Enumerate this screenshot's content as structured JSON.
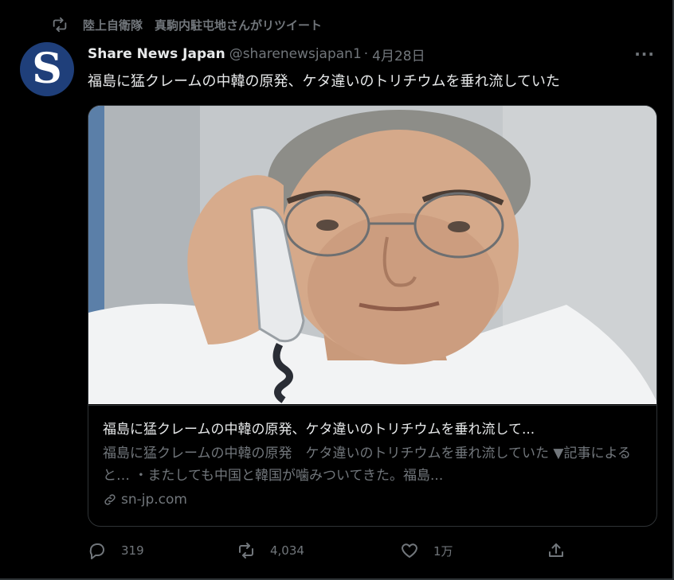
{
  "retweet": {
    "text": "陸上自衛隊　真駒内駐屯地さんがリツイート",
    "icon": "retweet-icon"
  },
  "tweet": {
    "avatar_letter": "S",
    "display_name": "Share News Japan",
    "handle": "@sharenewsjapan1",
    "separator": "·",
    "date": "4月28日",
    "more": "···",
    "text": "福島に猛クレームの中韓の原発、ケタ違いのトリチウムを垂れ流していた"
  },
  "card": {
    "title": "福島に猛クレームの中韓の原発、ケタ違いのトリチウムを垂れ流して...",
    "description": "福島に猛クレームの中韓の原発　ケタ違いのトリチウムを垂れ流していた ▼記事によると… ・またしても中国と韓国が噛みついてきた。福島...",
    "domain": "sn-jp.com"
  },
  "actions": {
    "reply_count": "319",
    "retweet_count": "4,034",
    "like_count": "1万"
  },
  "colors": {
    "background": "#000000",
    "text": "#e7e9ea",
    "secondary": "#71767b",
    "border": "#2f3336",
    "avatar": "#1f3f7a"
  }
}
